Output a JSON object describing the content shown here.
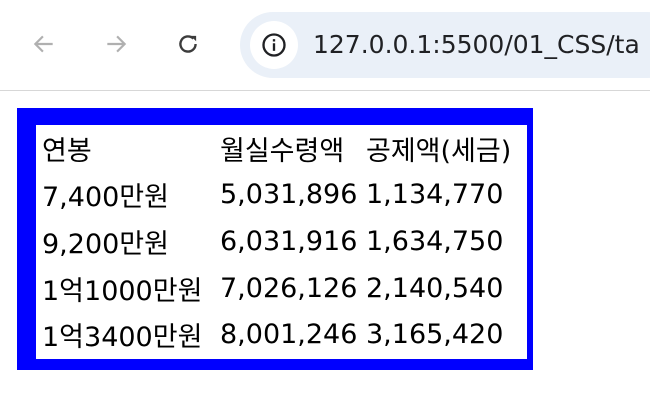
{
  "browser": {
    "url": "127.0.0.1:5500/01_CSS/ta"
  },
  "salary_table": {
    "headers": [
      "연봉",
      "월실수령액",
      "공제액(세금)"
    ],
    "rows": [
      [
        "7,400만원",
        "5,031,896",
        "1,134,770"
      ],
      [
        "9,200만원",
        "6,031,916",
        "1,634,750"
      ],
      [
        "1억1000만원",
        "7,026,126",
        "2,140,540"
      ],
      [
        "1억3400만원",
        "8,001,246",
        "3,165,420"
      ]
    ]
  },
  "colors": {
    "table_border": "#0000ff",
    "omnibox_bg": "#eaf0f8"
  },
  "icons": [
    "back-arrow-icon",
    "forward-arrow-icon",
    "reload-icon",
    "site-info-icon"
  ]
}
